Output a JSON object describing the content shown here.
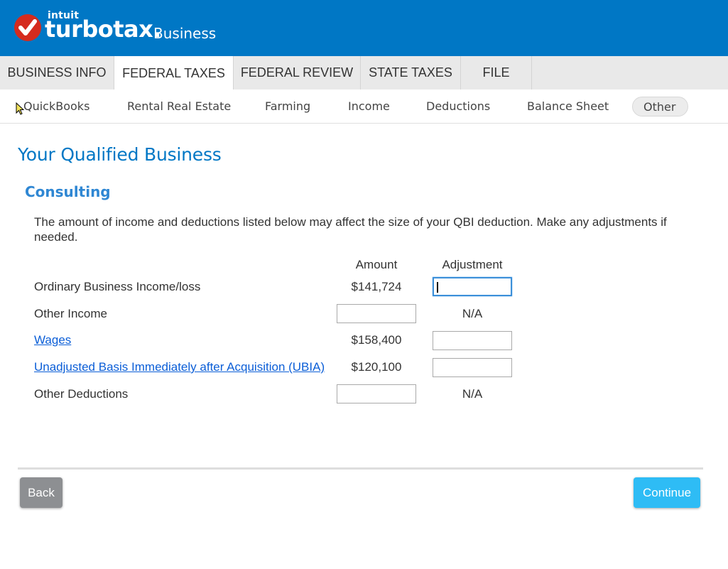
{
  "brand": {
    "intuit": "intuit",
    "turbotax": "turbotax",
    "dot": ".",
    "edition": "Business",
    "accent_color": "#0077c5",
    "check_color": "#d52b1e"
  },
  "main_tabs": [
    {
      "label": "BUSINESS INFO"
    },
    {
      "label": "FEDERAL TAXES",
      "active": true
    },
    {
      "label": "FEDERAL REVIEW"
    },
    {
      "label": "STATE TAXES"
    },
    {
      "label": "FILE"
    }
  ],
  "sub_tabs": [
    {
      "label": "QuickBooks"
    },
    {
      "label": "Rental Real Estate"
    },
    {
      "label": "Farming"
    },
    {
      "label": "Income"
    },
    {
      "label": "Deductions"
    },
    {
      "label": "Balance Sheet"
    },
    {
      "label": "Other",
      "active": true
    }
  ],
  "page": {
    "title": "Your Qualified Business",
    "section": "Consulting",
    "intro": "The amount of income and deductions listed below may affect the size of your QBI deduction. Make any adjustments if needed."
  },
  "table": {
    "headers": {
      "amount": "Amount",
      "adjustment": "Adjustment"
    },
    "rows": [
      {
        "label": "Ordinary Business Income/loss",
        "amount": "$141,724",
        "adjustment": "",
        "link": false
      },
      {
        "label": "Other Income",
        "amount": "",
        "adjustment": "N/A",
        "link": false
      },
      {
        "label": "Wages",
        "amount": "$158,400",
        "adjustment": "",
        "link": true
      },
      {
        "label": "Unadjusted Basis Immediately after Acquisition (UBIA)",
        "amount": "$120,100",
        "adjustment": "",
        "link": true
      },
      {
        "label": "Other Deductions",
        "amount": "",
        "adjustment": "N/A",
        "link": false
      }
    ]
  },
  "buttons": {
    "back": "Back",
    "continue": "Continue"
  }
}
